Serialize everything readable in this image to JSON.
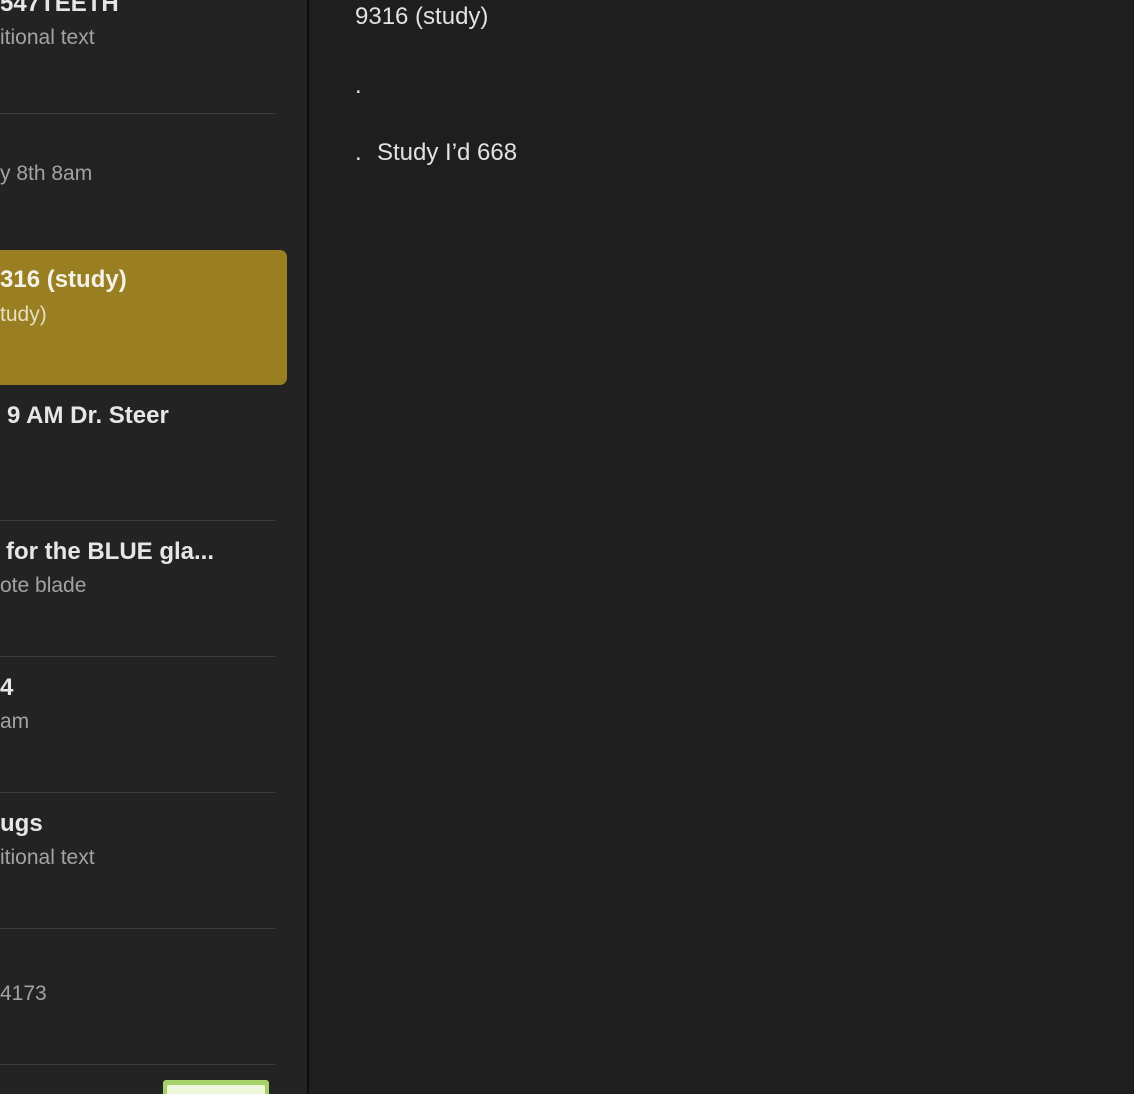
{
  "notes": [
    {
      "title": "547TEETH",
      "subtitle": "itional text"
    },
    {
      "title": "",
      "subtitle": "y 8th 8am"
    },
    {
      "title": "316 (study)",
      "subtitle": "tudy)"
    },
    {
      "title": "9 AM Dr. Steer",
      "subtitle": ""
    },
    {
      "title": "for the BLUE gla...",
      "subtitle": "ote blade"
    },
    {
      "title": "4",
      "subtitle": "am"
    },
    {
      "title": "ugs",
      "subtitle": "itional text"
    },
    {
      "title": "",
      "subtitle": "4173"
    }
  ],
  "editor": {
    "title_line": "9316 (study)",
    "bullet_line": ".",
    "line_three_bullet": ".",
    "line_three_text": "Study I’d 668"
  },
  "colors": {
    "selected_note_bg": "#9a7e22",
    "sidebar_bg": "#232323",
    "editor_bg": "#1e1e1e"
  }
}
